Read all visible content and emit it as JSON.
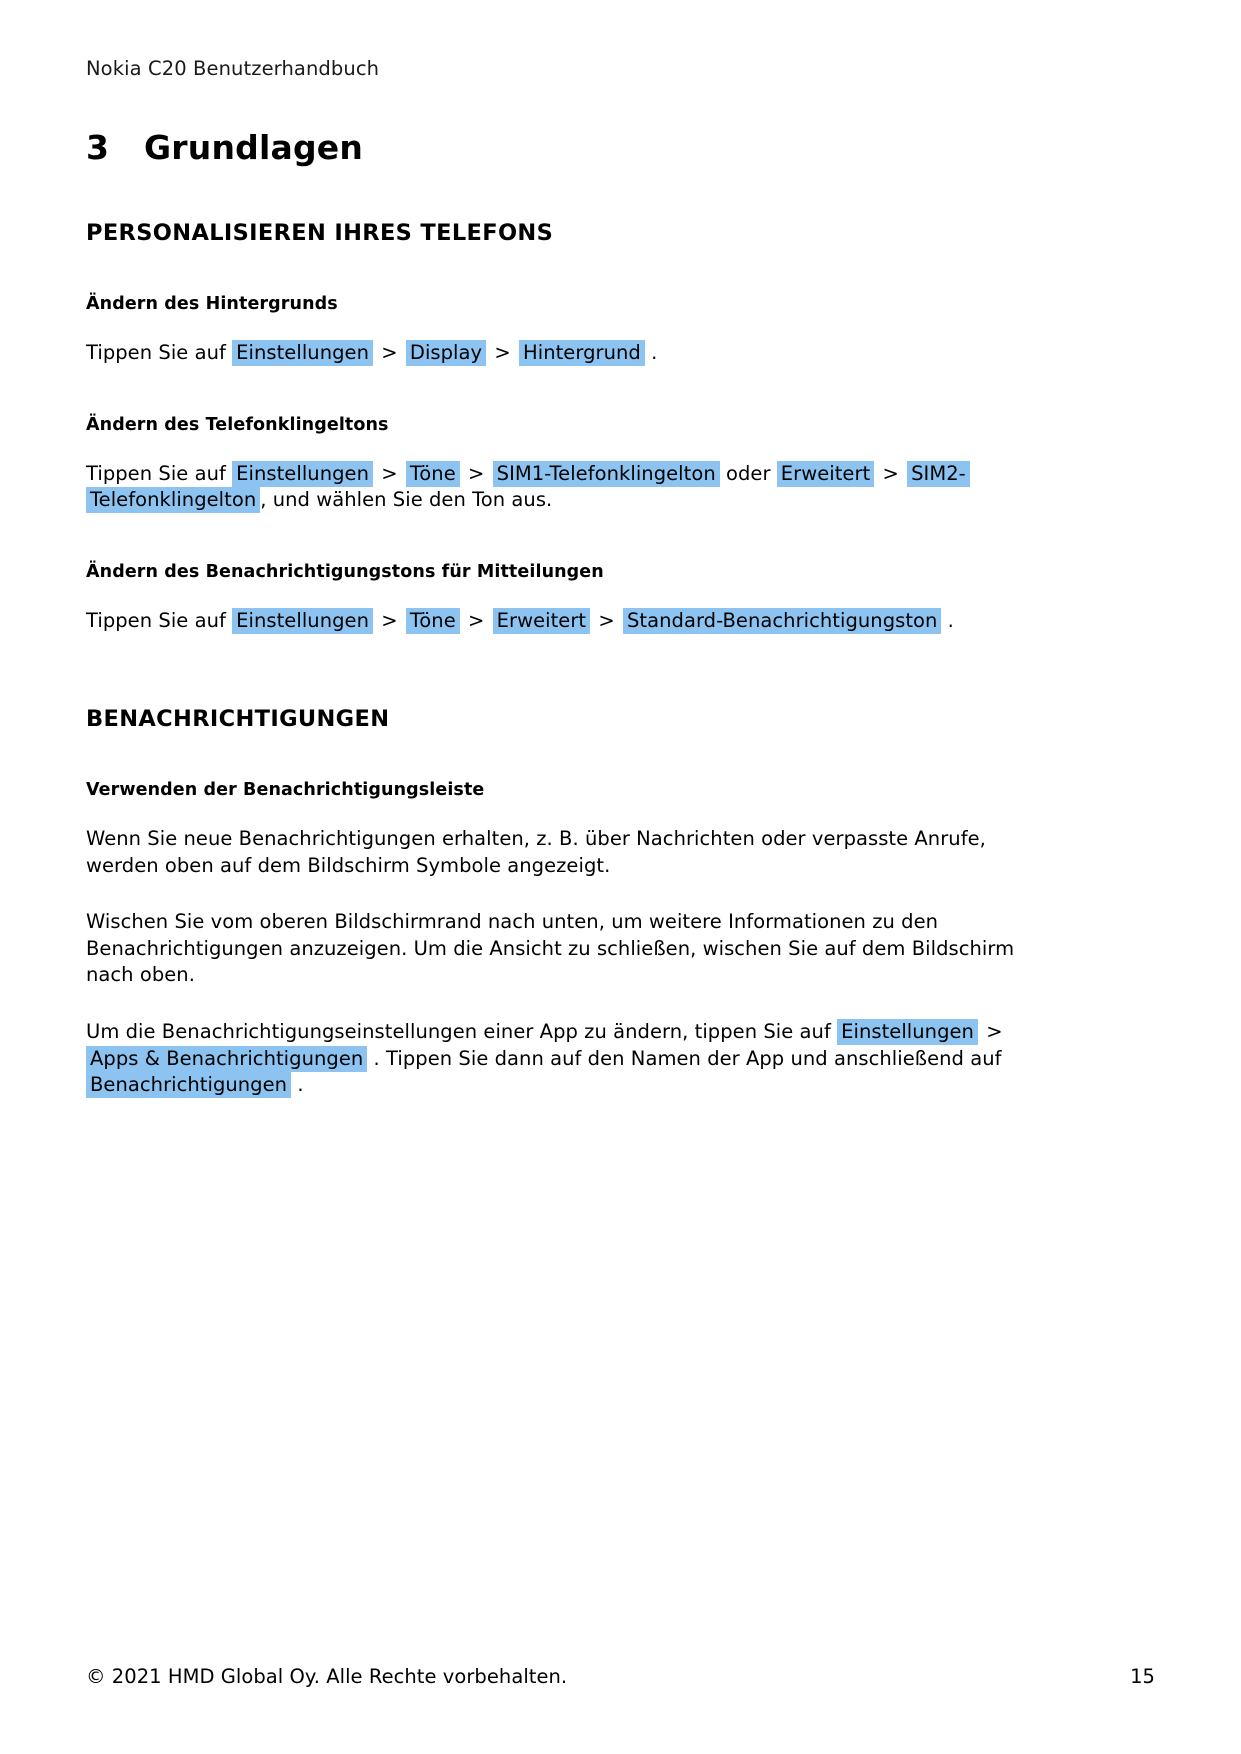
{
  "document": {
    "running_head": "Nokia C20 Benutzerhandbuch",
    "chapter_number": "3",
    "chapter_title": "Grundlagen",
    "highlight_color": "#8cc3f0"
  },
  "sections": {
    "personalization": {
      "heading": "PERSONALISIEREN IHRES TELEFONS",
      "wallpaper": {
        "heading": "Ändern des Hintergrunds",
        "intro": "Tippen Sie auf",
        "step1": "Einstellungen",
        "sep1": ">",
        "step2": "Display",
        "sep2": ">",
        "step3": "Hintergrund",
        "end": "."
      },
      "ringtone": {
        "heading": "Ändern des Telefonklingeltons",
        "intro": "Tippen Sie auf",
        "step1": "Einstellungen",
        "sep1": ">",
        "step2": "Töne",
        "sep2": ">",
        "step3": "SIM1-Telefonklingelton",
        "conjunction": "oder",
        "step4": "Erweitert",
        "sep3": ">",
        "step5": "SIM2-Telefonklingelton",
        "end": ", und wählen Sie den Ton aus."
      },
      "notification_sound": {
        "heading": "Ändern des Benachrichtigungstons für Mitteilungen",
        "intro": "Tippen Sie auf",
        "step1": "Einstellungen",
        "sep1": ">",
        "step2": "Töne",
        "sep2": ">",
        "step3": "Erweitert",
        "sep3": ">",
        "step4": "Standard-Benachrichtigungston",
        "end": "."
      }
    },
    "notifications": {
      "heading": "BENACHRICHTIGUNGEN",
      "status_bar": {
        "heading": "Verwenden der Benachrichtigungsleiste",
        "paragraph1": "Wenn Sie neue Benachrichtigungen erhalten, z. B. über Nachrichten oder verpasste Anrufe, werden oben auf dem Bildschirm Symbole angezeigt.",
        "paragraph2": "Wischen Sie vom oberen Bildschirmrand nach unten, um weitere Informationen zu den Benachrichtigungen anzuzeigen. Um die Ansicht zu schließen, wischen Sie auf dem Bildschirm nach oben.",
        "paragraph3": {
          "part1": "Um die Benachrichtigungseinstellungen einer App zu ändern, tippen Sie auf",
          "step1": "Einstellungen",
          "sep1": ">",
          "step2": "Apps & Benachrichtigungen",
          "part2": ". Tippen Sie dann auf den Namen der App und anschließend auf",
          "step3": "Benachrichtigungen",
          "end": "."
        }
      }
    }
  },
  "footer": {
    "copyright": "© 2021 HMD Global Oy. Alle Rechte vorbehalten.",
    "page_number": "15"
  }
}
